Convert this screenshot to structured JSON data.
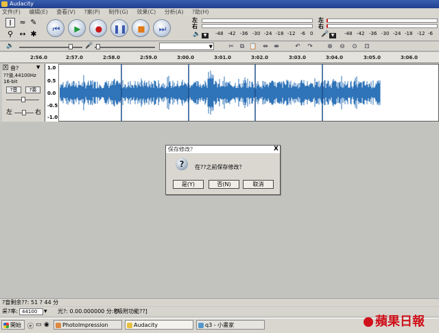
{
  "window": {
    "title": "Audacity"
  },
  "menu": [
    "文件(F)",
    "编辑(E)",
    "查看(V)",
    "?案(P)",
    "制作(G)",
    "效果(C)",
    "分析(A)",
    "?助(H)"
  ],
  "meters": {
    "left_label": "左",
    "right_label": "右",
    "scale": [
      "-48",
      "-42",
      "-36",
      "-30",
      "-24",
      "-18",
      "-12",
      "-6",
      "0"
    ]
  },
  "ruler": [
    "2:56.0",
    "2:57.0",
    "2:58.0",
    "2:59.0",
    "3:00.0",
    "3:01.0",
    "3:02.0",
    "3:03.0",
    "3:04.0",
    "3:05.0",
    "3:06.0"
  ],
  "track": {
    "close": "X",
    "name": "音?",
    "dropdown": "▼",
    "format": "??道,44100Hz",
    "bitdepth": "16-bit",
    "mute_label": "?音",
    "solo_label": "?奏",
    "pan_left": "左",
    "pan_right": "右",
    "y_ticks": [
      "1.0",
      "0.5",
      "0.0",
      "-0.5",
      "-1.0"
    ]
  },
  "dialog": {
    "title": "保存修改？",
    "close": "X",
    "message": "在??之前保存修改？",
    "yes": "是(Y)",
    "no": "否(N)",
    "cancel": "取消"
  },
  "status": {
    "disk": "?盲剩余??: 51 ? 44 分",
    "rate_label": "采?率:",
    "rate_value": "44100",
    "cursor": "光?: 0.00.000000 分:秒",
    "snap": "[吸附功能??]"
  },
  "taskbar": {
    "start": "開始",
    "items": [
      "PhotoImpression",
      "Audacity",
      "q3 - 小畫家"
    ]
  },
  "watermark": "蘋果日報",
  "colors": {
    "waveform": "#2f73b8",
    "titlebar": "#2a4a9e",
    "logo": "#d0101a"
  }
}
